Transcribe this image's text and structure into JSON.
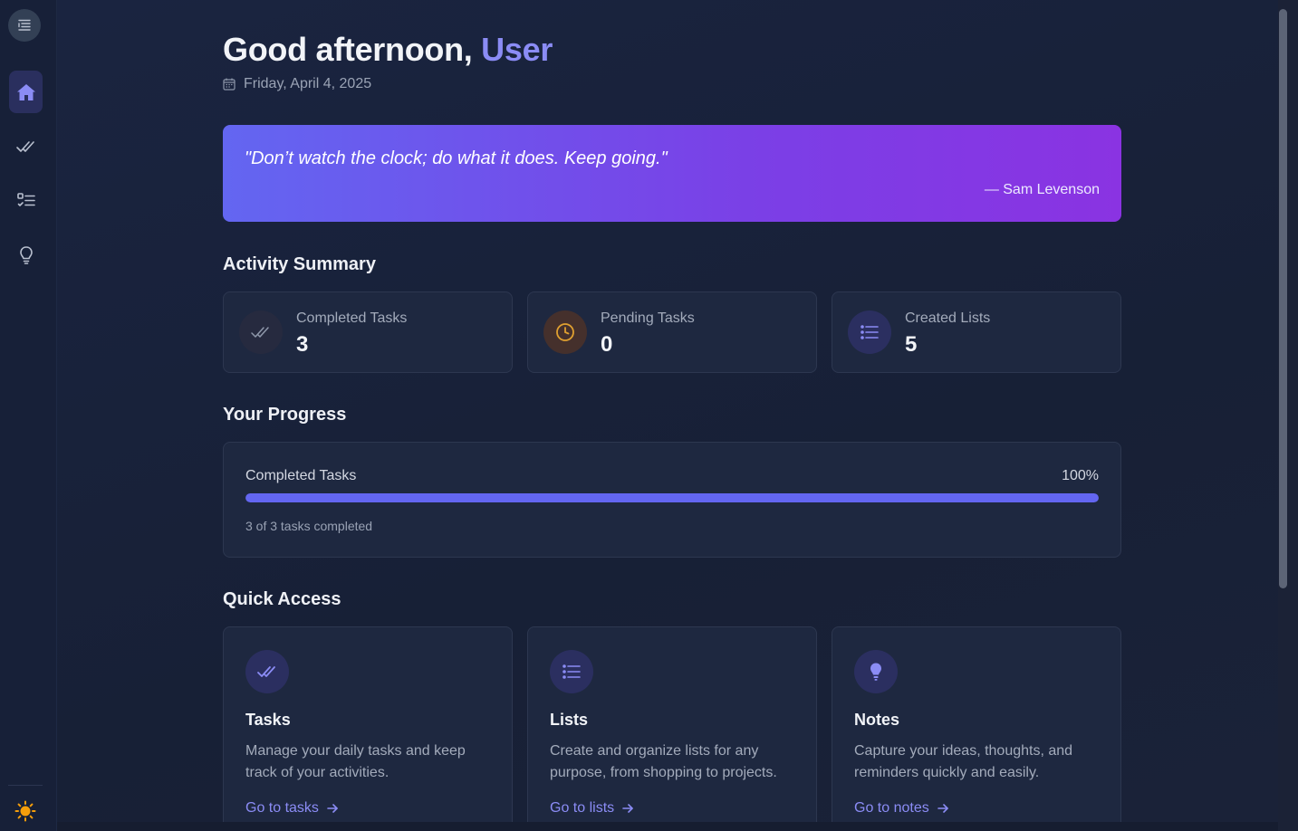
{
  "greeting": {
    "prefix": "Good afternoon,",
    "name": "User"
  },
  "date": "Friday, April 4, 2025",
  "quote": {
    "text": "\"Don’t watch the clock; do what it does. Keep going.\"",
    "author": "— Sam Levenson"
  },
  "activity": {
    "title": "Activity Summary",
    "cards": [
      {
        "label": "Completed Tasks",
        "value": "3",
        "icon": "double-check-icon"
      },
      {
        "label": "Pending Tasks",
        "value": "0",
        "icon": "clock-icon"
      },
      {
        "label": "Created Lists",
        "value": "5",
        "icon": "list-icon"
      }
    ]
  },
  "progress": {
    "title": "Your Progress",
    "label": "Completed Tasks",
    "percent_text": "100%",
    "fraction": 1.0,
    "subtext": "3 of 3 tasks completed"
  },
  "quick_access": {
    "title": "Quick Access",
    "cards": [
      {
        "title": "Tasks",
        "desc": "Manage your daily tasks and keep track of your activities.",
        "link": "Go to tasks",
        "icon": "double-check-icon"
      },
      {
        "title": "Lists",
        "desc": "Create and organize lists for any purpose, from shopping to projects.",
        "link": "Go to lists",
        "icon": "list-icon"
      },
      {
        "title": "Notes",
        "desc": "Capture your ideas, thoughts, and reminders quickly and easily.",
        "link": "Go to notes",
        "icon": "lightbulb-icon"
      }
    ]
  },
  "sidebar": {
    "items": [
      {
        "name": "home",
        "icon": "home-icon",
        "active": true
      },
      {
        "name": "tasks",
        "icon": "double-check-icon",
        "active": false
      },
      {
        "name": "lists",
        "icon": "checklist-icon",
        "active": false
      },
      {
        "name": "notes",
        "icon": "lightbulb-icon",
        "active": false
      }
    ],
    "theme_icon": "sun-icon"
  },
  "colors": {
    "accent": "#6366f1",
    "accent_text": "#8b8cf5",
    "quote_gradient_start": "#6366f1",
    "quote_gradient_end": "#8a33e2",
    "pending_icon": "#e0a030",
    "sun": "#f59e0b"
  }
}
